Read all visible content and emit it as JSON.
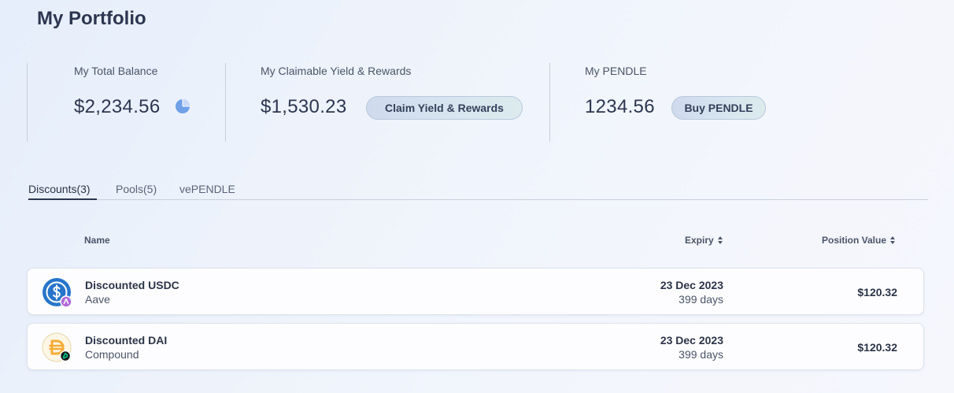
{
  "page": {
    "title": "My Portfolio"
  },
  "stats": {
    "total_balance": {
      "label": "My Total Balance",
      "value": "$2,234.56",
      "icon": "pie-chart-icon"
    },
    "claimable": {
      "label": "My Claimable Yield & Rewards",
      "value": "$1,530.23",
      "button": "Claim Yield & Rewards"
    },
    "pendle": {
      "label": "My PENDLE",
      "value": "1234.56",
      "button": "Buy PENDLE"
    }
  },
  "tabs": [
    {
      "label": "Discounts(3)",
      "active": true
    },
    {
      "label": "Pools(5)",
      "active": false
    },
    {
      "label": "vePENDLE",
      "active": false
    }
  ],
  "table": {
    "columns": {
      "name": "Name",
      "expiry": "Expiry",
      "position_value": "Position Value"
    },
    "rows": [
      {
        "name": "Discounted USDC",
        "protocol": "Aave",
        "expiry_date": "23 Dec 2023",
        "expiry_days": "399 days",
        "value": "$120.32",
        "icon": "usdc-icon",
        "badge": "aave-icon"
      },
      {
        "name": "Discounted DAI",
        "protocol": "Compound",
        "expiry_date": "23 Dec 2023",
        "expiry_days": "399 days",
        "value": "$120.32",
        "icon": "dai-icon",
        "badge": "compound-icon"
      }
    ]
  },
  "colors": {
    "accent": "#2d3650",
    "usdc": "#2775ca",
    "dai": "#f5ac37",
    "pie": "#6fa0e8"
  }
}
